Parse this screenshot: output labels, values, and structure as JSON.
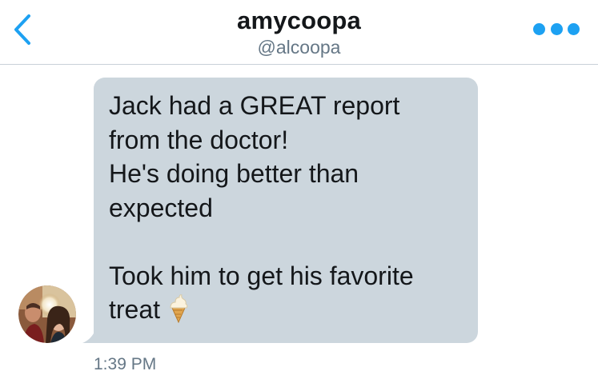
{
  "header": {
    "back_icon": "chevron-left-icon",
    "title": "amycoopa",
    "handle": "@alcoopa",
    "more_icon": "more-dots-icon"
  },
  "colors": {
    "accent": "#1da1f2",
    "bubble": "#ccd6dd",
    "secondary_text": "#657786",
    "divider": "#c9d1d8"
  },
  "message": {
    "lines": [
      "Jack had a GREAT report",
      "from the doctor!",
      "He's doing better than",
      "expected",
      "",
      "Took him to get his favorite",
      "treat"
    ],
    "emoji": "soft-ice-cream-icon",
    "timestamp": "1:39 PM"
  },
  "avatar": {
    "icon": "user-avatar-photo"
  }
}
